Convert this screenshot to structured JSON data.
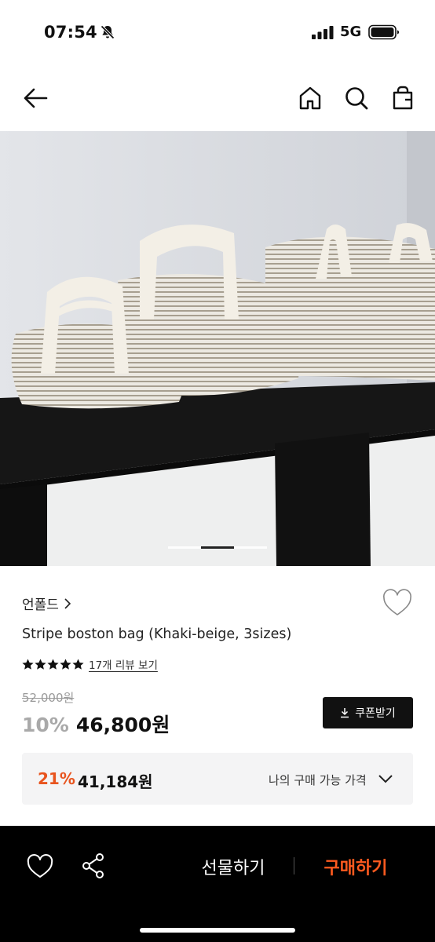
{
  "status_bar": {
    "time": "07:54",
    "network": "5G",
    "icons": [
      "bell-slash-icon",
      "signal-bars-icon",
      "battery-icon"
    ]
  },
  "header": {
    "icons": [
      "back-arrow-icon",
      "home-icon",
      "search-icon",
      "shopping-bag-icon"
    ]
  },
  "product": {
    "image_alt_icon": "product-photo",
    "gallery_pages": 3,
    "gallery_active_page": 2,
    "brand": "언폴드",
    "title": "Stripe boston bag (Khaki-beige, 3sizes)",
    "rating_stars": 5,
    "review_link": "17개 리뷰 보기",
    "original_price": "52,000원",
    "discount_rate": "10%",
    "sale_price": "46,800원",
    "coupon_button": "쿠폰받기"
  },
  "my_price": {
    "discount_rate": "21%",
    "price": "41,184원",
    "label": "나의 구매 가능 가격"
  },
  "bottom_bar": {
    "gift_label": "선물하기",
    "buy_label": "구매하기"
  },
  "colors": {
    "accent": "#ff5a1f",
    "discount_accent": "#e8541e",
    "bottom_bar_bg": "#000000",
    "coupon_bg": "#111111",
    "panel_bg": "#f4f4f5"
  }
}
